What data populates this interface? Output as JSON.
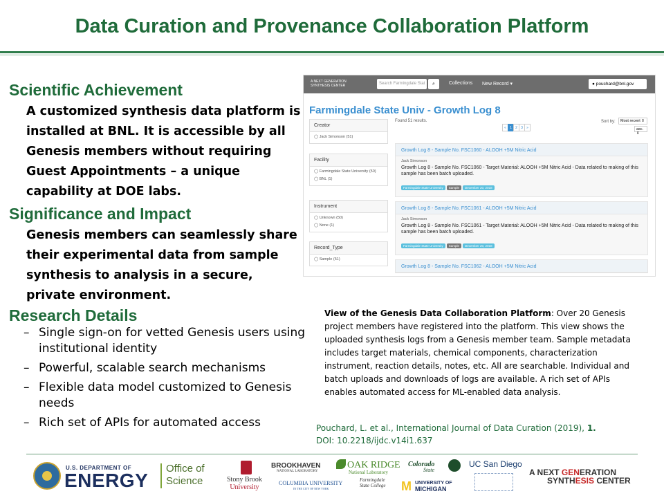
{
  "title": "Data Curation and Provenance Collaboration Platform",
  "sections": {
    "achievement": {
      "heading": "Scientific Achievement",
      "body": "A customized synthesis data platform is installed at BNL.  It is accessible by all Genesis members without requiring Guest Appointments – a unique capability at DOE labs."
    },
    "impact": {
      "heading": "Significance and Impact",
      "body": "Genesis members can seamlessly share their experimental data from sample synthesis to analysis in a secure, private environment."
    },
    "details": {
      "heading": "Research Details",
      "bullets": [
        "Single sign-on for vetted Genesis users using institutional identity",
        "Powerful, scalable search mechanisms",
        "Flexible data model customized to Genesis needs",
        "Rich set of APIs for automated access"
      ],
      "bullet_marker": "–"
    }
  },
  "screenshot": {
    "nav": {
      "logo": "A NEXT GENERATION SYNTHESIS CENTER",
      "search_placeholder": "Search Farmingdale Stat",
      "collections": "Collections",
      "new_record": "New Record ▾",
      "user": "pouchard@bnl.gov"
    },
    "page_title": "Farmingdale State Univ - Growth Log 8",
    "found": "Found 51 results.",
    "pager": [
      "«",
      "1",
      "2",
      "3",
      "»"
    ],
    "sort_label": "Sort by:",
    "sort_value": "Most recent ⇕",
    "sort_order": "asc. ⇕",
    "facets": [
      {
        "heading": "Creator",
        "items": [
          "Jack Simonson (51)"
        ]
      },
      {
        "heading": "Facility",
        "items": [
          "Farmingdale State University (50)",
          "BNL (1)"
        ]
      },
      {
        "heading": "Instrument",
        "items": [
          "Unknown (50)",
          "None (1)"
        ]
      },
      {
        "heading": "Record_Type",
        "items": [
          "Sample (51)"
        ]
      }
    ],
    "records": [
      {
        "title": "Growth Log 8 - Sample No. FSC1060 - ALOOH +5M Nitric Acid",
        "author": "Jack Simonson",
        "desc": "Growth Log 8 - Sample No. FSC1060 - Target Material: ALOOH +5M Nitric Acid - Data related to making of this sample has been batch uploaded.",
        "tags": [
          "Farmingdale State University",
          "Sample",
          "December 20, 2018"
        ]
      },
      {
        "title": "Growth Log 8 - Sample No. FSC1061 - ALOOH +5M Nitric Acid",
        "author": "Jack Simonson",
        "desc": "Growth Log 8 - Sample No. FSC1061 - Target Material: ALOOH +5M Nitric Acid - Data related to making of this sample has been batch uploaded.",
        "tags": [
          "Farmingdale State University",
          "Sample",
          "December 20, 2018"
        ]
      },
      {
        "title": "Growth Log 8 - Sample No. FSC1062 - ALOOH +5M Nitric Acid",
        "author": "",
        "desc": "",
        "tags": []
      }
    ]
  },
  "caption": {
    "lead": "View of the Genesis Data Collaboration Platform",
    "text": ": Over 20 Genesis project members have registered into the platform.  This view shows the uploaded synthesis logs from a Genesis member team. Sample metadata includes target materials, chemical components, characterization instrument, reaction details, notes, etc. All are searchable.  Individual and batch uploads and downloads of logs are available.  A rich set of APIs enables automated access for ML-enabled data analysis."
  },
  "citation": {
    "text": "Pouchard, L. et al., International Journal of Data Curation (2019), ",
    "volume": "1.",
    "doi": "DOI: 10.2218/ijdc.v14i1.637"
  },
  "footer": {
    "doe_top": "U.S. DEPARTMENT OF",
    "doe_main": "ENERGY",
    "office": [
      "Office of",
      "Science"
    ],
    "partners": {
      "stonybrook": [
        "Stony Brook",
        "University"
      ],
      "brookhaven": "BROOKHAVEN",
      "brookhaven_sub": "NATIONAL LABORATORY",
      "ornl": "OAK RIDGE",
      "ornl_sub": "National Laboratory",
      "colorado": "Colorado",
      "colorado_sub": "State",
      "ucsd": "UC San Diego",
      "columbia": "COLUMBIA UNIVERSITY",
      "columbia_sub": "IN THE CITY OF NEW YORK",
      "farmingdale": [
        "Farmingdale",
        "State College"
      ],
      "michigan_mark": "M",
      "michigan": [
        "UNIVERSITY OF",
        "MICHIGAN"
      ]
    },
    "nextgen": {
      "l1a": "A NEXT ",
      "l1b": "GEN",
      "l1c": "ERATION",
      "l2a": "SYNTH",
      "l2b": "ESIS",
      "l2c": " CENTER"
    }
  },
  "colors": {
    "title_green": "#1f6b3a",
    "link_blue": "#3a8fd0",
    "nextgen_red": "#c62828"
  }
}
